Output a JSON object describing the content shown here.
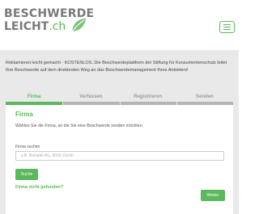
{
  "header": {
    "logo_line1": "BESCHWERDE",
    "logo_line2": "LEICHT",
    "logo_tld": ".ch",
    "logo_icon": "leaf-icon",
    "menu_icon": "hamburger-icon"
  },
  "intro": {
    "text": "Reklamieren leicht gemacht - KOSTENLOS. Die Beschwerdeplattform der Stiftung für Konsumentenschutz leitet Ihre Beschwerde auf dem direktesten Weg an das Beschwerdemanagement Ihres Anbieters!"
  },
  "steps": [
    {
      "label": "Firma",
      "active": true
    },
    {
      "label": "Verfassen",
      "active": false
    },
    {
      "label": "Registrieren",
      "active": false
    },
    {
      "label": "Senden",
      "active": false
    }
  ],
  "panel": {
    "title": "Firma",
    "subtitle": "Wählen Sie die Firma, an die Sie eine Beschwerde senden möchten.",
    "search_label": "Firma suchen",
    "search_placeholder": "z.B. Beispiel AG, 8000 Zürich",
    "search_value": "",
    "search_button": "Suche",
    "not_found_link": "Firma nicht gefunden?",
    "next_button": "Weiter"
  },
  "colors": {
    "accent": "#5cb85c",
    "background": "#e9e9e9",
    "step_inactive": "#b5b5b5"
  }
}
